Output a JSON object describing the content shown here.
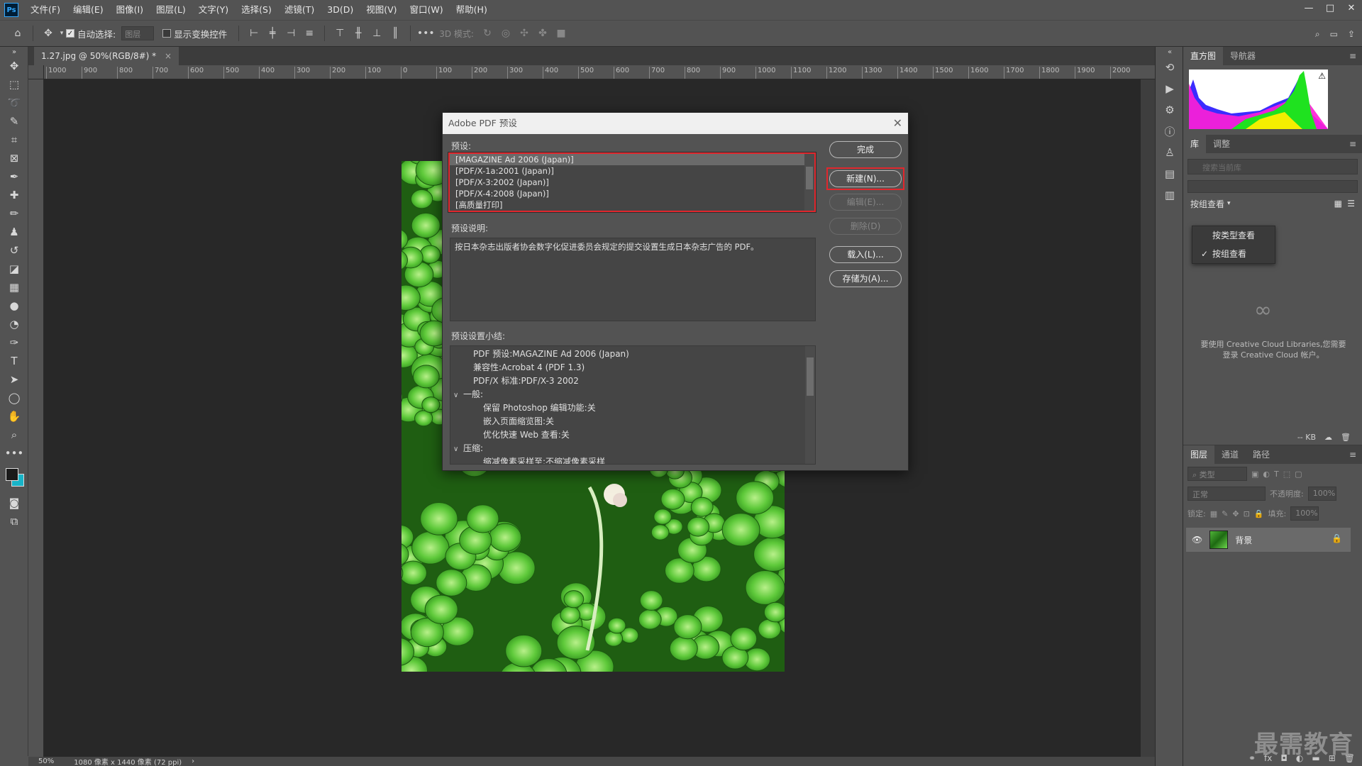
{
  "app": {
    "logo": "Ps",
    "menu": [
      "文件(F)",
      "编辑(E)",
      "图像(I)",
      "图层(L)",
      "文字(Y)",
      "选择(S)",
      "滤镜(T)",
      "3D(D)",
      "视图(V)",
      "窗口(W)",
      "帮助(H)"
    ],
    "window_controls": [
      "—",
      "□",
      "✕"
    ]
  },
  "options_bar": {
    "auto_select_label": "自动选择:",
    "auto_select_value": "图层",
    "show_transform_label": "显示变换控件",
    "mode_3d_label": "3D 模式:"
  },
  "document": {
    "tab_title": "1.27.jpg @ 50%(RGB/8#) *",
    "ruler_ticks": [
      "1000",
      "900",
      "800",
      "700",
      "600",
      "500",
      "400",
      "300",
      "200",
      "100",
      "0",
      "100",
      "200",
      "300",
      "400",
      "500",
      "600",
      "700",
      "800",
      "900",
      "1000",
      "1100",
      "1200",
      "1300",
      "1400",
      "1500",
      "1600",
      "1700",
      "1800",
      "1900",
      "2000"
    ],
    "status_zoom": "50%",
    "status_info": "1080 像素 x 1440 像素 (72 ppi)"
  },
  "dialog": {
    "title": "Adobe PDF 预设",
    "preset_label": "预设:",
    "presets": [
      "[MAGAZINE Ad 2006 (Japan)]",
      "[PDF/X-1a:2001 (Japan)]",
      "[PDF/X-3:2002 (Japan)]",
      "[PDF/X-4:2008 (Japan)]",
      "[高质量打印]"
    ],
    "description_label": "预设说明:",
    "description": "按日本杂志出版者协会数字化促进委员会规定的提交设置生成日本杂志广告的 PDF。",
    "summary_label": "预设设置小结:",
    "summary": [
      {
        "indent": 1,
        "arrow": "",
        "text": "PDF 预设:MAGAZINE Ad 2006 (Japan)"
      },
      {
        "indent": 1,
        "arrow": "",
        "text": "兼容性:Acrobat 4 (PDF 1.3)"
      },
      {
        "indent": 1,
        "arrow": "",
        "text": "PDF/X 标准:PDF/X-3 2002"
      },
      {
        "indent": 0,
        "arrow": "∨",
        "text": "一般:"
      },
      {
        "indent": 2,
        "arrow": "",
        "text": "保留 Photoshop 编辑功能:关"
      },
      {
        "indent": 2,
        "arrow": "",
        "text": "嵌入页面缩览图:关"
      },
      {
        "indent": 2,
        "arrow": "",
        "text": "优化快速 Web 查看:关"
      },
      {
        "indent": 0,
        "arrow": "∨",
        "text": "压缩:"
      },
      {
        "indent": 2,
        "arrow": "",
        "text": "缩减像素采样至:不缩减像素采样"
      }
    ],
    "buttons": {
      "done": "完成",
      "new": "新建(N)...",
      "edit": "编辑(E)...",
      "delete": "删除(D)",
      "load": "载入(L)...",
      "save_as": "存储为(A)..."
    },
    "highlight_color": "#e0272d"
  },
  "right_panel": {
    "top_tabs": [
      "直方图",
      "导航器"
    ],
    "lib_tabs": [
      "库",
      "调整"
    ],
    "lib_search_placeholder": "搜索当前库",
    "lib_view_label": "按组查看",
    "lib_view_options": [
      {
        "label": "按类型查看",
        "checked": false
      },
      {
        "label": "按组查看",
        "checked": true
      }
    ],
    "lib_message": "要使用 Creative Cloud Libraries,您需要登录 Creative Cloud 帐户。",
    "lib_size": "-- KB",
    "layer_tabs": [
      "图层",
      "通道",
      "路径"
    ],
    "layer_filter": "类型",
    "blend_mode": "正常",
    "opacity_label": "不透明度:",
    "opacity_value": "100%",
    "lock_label": "锁定:",
    "fill_label": "填充:",
    "fill_value": "100%",
    "layer_name": "背景"
  },
  "watermark": "最需教育"
}
